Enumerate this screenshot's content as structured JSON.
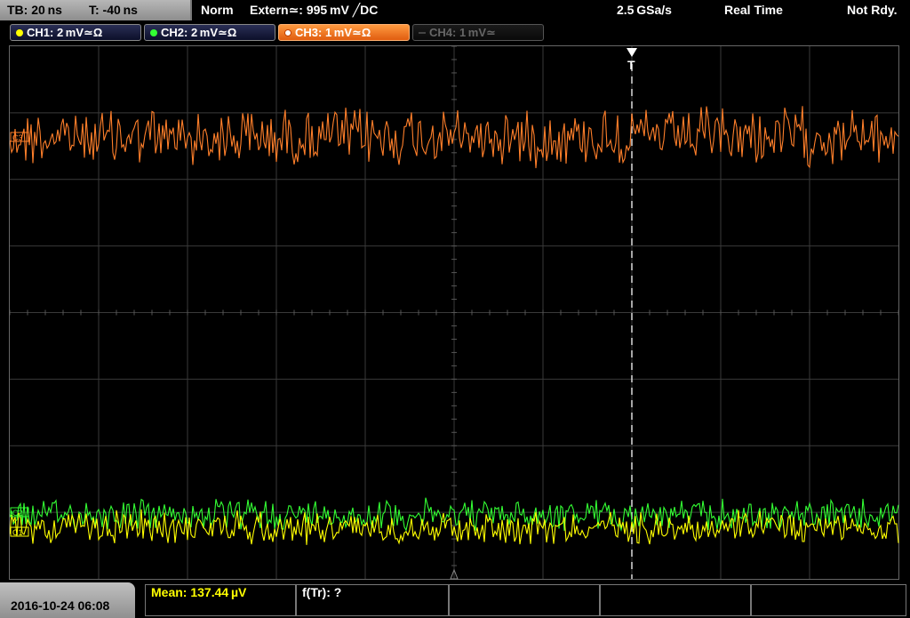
{
  "top_bar": {
    "timebase": "TB: 20 ns",
    "trigger_time": "T: -40 ns",
    "mode": "Norm",
    "trigger_source": "Extern≃: 995 mV ╱DC",
    "sample_rate": "2.5 GSa/s",
    "acquisition": "Real Time",
    "status": "Not Rdy."
  },
  "channels": [
    {
      "label": "CH1: 2 mV≃Ω",
      "color": "#ffff00",
      "state": "on"
    },
    {
      "label": "CH2: 2 mV≃Ω",
      "color": "#33ff33",
      "state": "on"
    },
    {
      "label": "CH3: 1 mV≃Ω",
      "color": "#ff8c30",
      "state": "active"
    },
    {
      "label": "CH4: 1 mV≃",
      "color": "#666666",
      "state": "off"
    }
  ],
  "markers": {
    "ch3_marker": "C3",
    "ch2_marker": "C2",
    "ch1_marker": "C1",
    "trigger_marker": "T"
  },
  "waveform_colors": {
    "ch1": "#ffff00",
    "ch2": "#33ff33",
    "ch3": "#ff7f2a"
  },
  "bottom": {
    "datetime": "2016-10-24 06:08",
    "measurement1": "Mean: 137.44 µV",
    "measurement2": "f(Tr): ?"
  }
}
